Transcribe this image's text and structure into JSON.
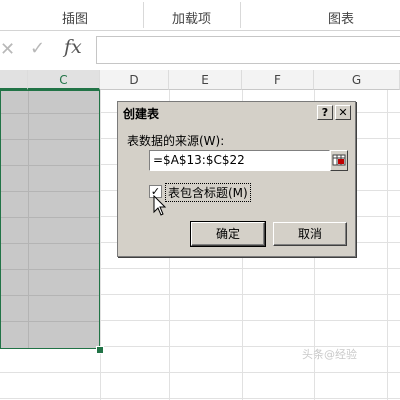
{
  "ribbon": {
    "groups": [
      "插图",
      "加载项",
      "图表"
    ],
    "cut_labels": [
      "图",
      "图表",
      "—",
      "—"
    ]
  },
  "formula_bar": {
    "cancel_icon": "close-icon",
    "enter_icon": "check-icon",
    "fx_label": "fx",
    "value": ""
  },
  "columns": [
    "C",
    "D",
    "E",
    "F",
    "G"
  ],
  "dialog": {
    "title": "创建表",
    "help_btn": "?",
    "close_btn": "✕",
    "source_label": "表数据的来源(W):",
    "range_value": "=$A$13:$C$22",
    "checkbox_checked": true,
    "checkbox_label": "表包含标题(M)",
    "ok_label": "确定",
    "cancel_label": "取消"
  },
  "watermark": "头条@经验"
}
